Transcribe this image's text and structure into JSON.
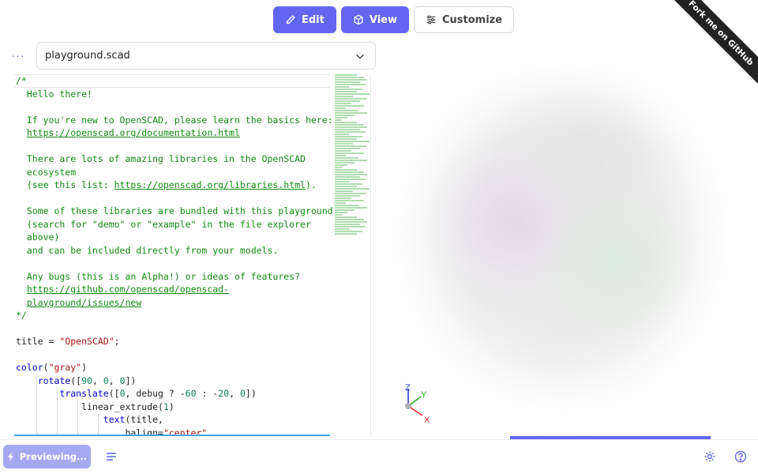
{
  "toolbar": {
    "edit_label": "Edit",
    "view_label": "View",
    "customize_label": "Customize"
  },
  "ribbon": {
    "text": "Fork me on GitHub"
  },
  "file": {
    "more_label": "···",
    "name": "playground.scad"
  },
  "code": {
    "lines": [
      "/*",
      "  Hello there!",
      "",
      "  If you're new to OpenSCAD, please learn the basics here:",
      "  https://openscad.org/documentation.html",
      "",
      "  There are lots of amazing libraries in the OpenSCAD",
      "  ecosystem",
      "  (see this list: https://openscad.org/libraries.html).",
      "",
      "  Some of these libraries are bundled with this playground",
      "  (search for \"demo\" or \"example\" in the file explorer",
      "  above)",
      "  and can be included directly from your models.",
      "",
      "  Any bugs (this is an Alpha!) or ideas of features?",
      "  https://github.com/openscad/openscad-",
      "  playground/issues/new",
      "*/",
      "",
      "title = \"OpenSCAD\";",
      "",
      "color(\"gray\")",
      "    rotate([90, 0, 0])",
      "        translate([0, debug ? -60 : -20, 0])",
      "            linear_extrude(1)",
      "                text(title,",
      "                    halign=\"center\","
    ]
  },
  "viewer": {
    "axis_x": "X",
    "axis_y": "Y",
    "axis_z": "Z",
    "progress_fraction": 0.52
  },
  "footer": {
    "preview_label": "Previewing...",
    "menu_icon": "list-icon",
    "settings_icon": "gear-icon",
    "help_icon": "help-icon"
  },
  "colors": {
    "accent": "#6366f1",
    "comment": "#118a11",
    "string": "#a31515"
  }
}
